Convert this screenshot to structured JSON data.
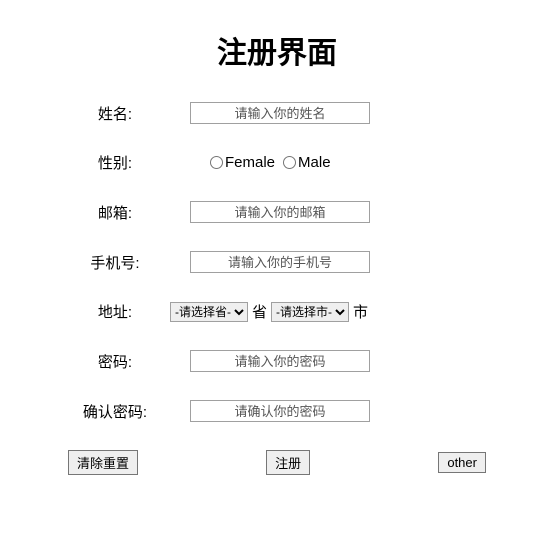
{
  "title": "注册界面",
  "fields": {
    "name": {
      "label": "姓名:",
      "placeholder": "请输入你的姓名"
    },
    "gender": {
      "label": "性别:",
      "option_female": "Female",
      "option_male": "Male"
    },
    "email": {
      "label": "邮箱:",
      "placeholder": "请输入你的邮箱"
    },
    "phone": {
      "label": "手机号:",
      "placeholder": "请输入你的手机号"
    },
    "address": {
      "label": "地址:",
      "province_selected": "-请选择省-",
      "province_suffix": "省",
      "city_selected": "-请选择市-",
      "city_suffix": "市"
    },
    "password": {
      "label": "密码:",
      "placeholder": "请输入你的密码"
    },
    "confirm": {
      "label": "确认密码:",
      "placeholder": "请确认你的密码"
    }
  },
  "buttons": {
    "reset": "清除重置",
    "submit": "注册",
    "other": "other"
  }
}
